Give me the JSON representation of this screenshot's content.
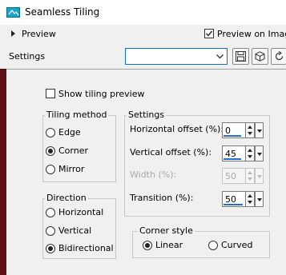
{
  "window": {
    "title": "Seamless Tiling",
    "icon": "seamless-tiling-app-icon"
  },
  "preview": {
    "label": "Preview",
    "preview_on_image_label": "Preview on Image",
    "preview_on_image_checked": true
  },
  "settings_row": {
    "label": "Settings",
    "preset_value": "",
    "tools": [
      "save-preset-icon",
      "manage-presets-icon",
      "reset-icon"
    ]
  },
  "show_tiling_preview": {
    "label": "Show tiling preview",
    "checked": false
  },
  "tiling_method": {
    "legend": "Tiling method",
    "options": [
      "Edge",
      "Corner",
      "Mirror"
    ],
    "selected": "Corner"
  },
  "direction": {
    "legend": "Direction",
    "options": [
      "Horizontal",
      "Vertical",
      "Bidirectional"
    ],
    "selected": "Bidirectional"
  },
  "settings": {
    "legend": "Settings",
    "horizontal_offset": {
      "label": "Horizontal offset (%):",
      "value": "0"
    },
    "vertical_offset": {
      "label": "Vertical offset (%):",
      "value": "45"
    },
    "width": {
      "label": "Width (%):",
      "value": "50",
      "enabled": false
    },
    "transition": {
      "label": "Transition (%):",
      "value": "50"
    }
  },
  "corner_style": {
    "legend": "Corner style",
    "options": [
      "Linear",
      "Curved"
    ],
    "selected": "Linear"
  },
  "colors": {
    "accent": "#1f6fd6",
    "side_strip": "#5a1212",
    "app_icon": "#1aa4c4"
  }
}
